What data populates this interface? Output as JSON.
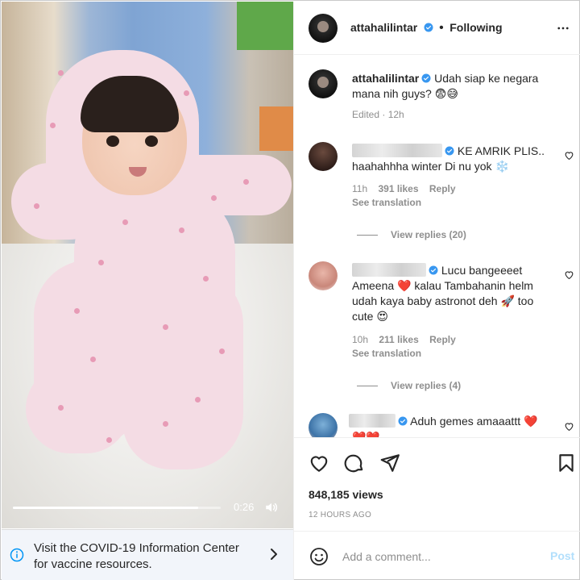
{
  "media": {
    "time": "0:26",
    "progress": 0.89,
    "volume_icon": "volume-icon"
  },
  "covid_banner": {
    "text": "Visit the COVID-19 Information Center for vaccine resources.",
    "icon": "info-icon"
  },
  "header": {
    "username": "attahalilintar",
    "follow_label": "Following",
    "verified": true
  },
  "caption": {
    "username": "attahalilintar",
    "text": "Udah siap ke negara mana nih guys? 😨😅",
    "edited": "Edited · 12h"
  },
  "comments": [
    {
      "text": "KE AMRIK PLIS.. haahahhha winter Di nu yok ❄️",
      "time": "11h",
      "likes": "391 likes",
      "reply": "Reply",
      "translation": "See translation",
      "view_replies": "View replies (20)"
    },
    {
      "text": "Lucu bangeeeet Ameena ❤️ kalau Tambahanin helm udah kaya baby astronot deh 🚀 too cute 😍",
      "time": "10h",
      "likes": "211 likes",
      "reply": "Reply",
      "translation": "See translation",
      "view_replies": "View replies (4)"
    },
    {
      "text": "Aduh gemes amaaattt ❤️",
      "extra": "❤️❤️"
    }
  ],
  "stats": {
    "views": "848,185 views",
    "ago": "12 HOURS AGO"
  },
  "add_comment": {
    "placeholder": "Add a comment...",
    "post_label": "Post"
  },
  "colors": {
    "verified": "#3897f0",
    "link_muted": "#8e8e8e",
    "post_disabled": "#b2dffc"
  }
}
